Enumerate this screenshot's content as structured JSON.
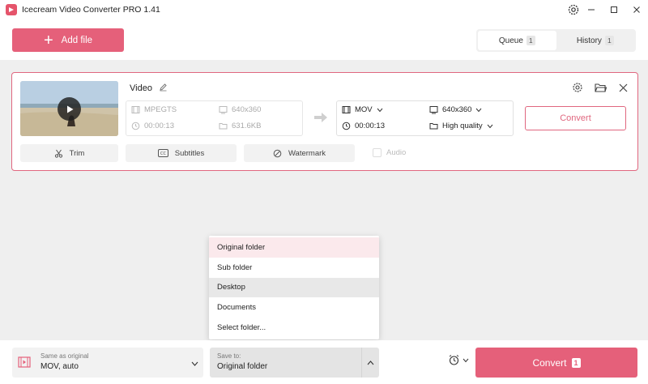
{
  "window": {
    "title": "Icecream Video Converter PRO 1.41"
  },
  "toolbar": {
    "add_file_label": "Add file",
    "tabs": [
      {
        "label": "Queue",
        "count": "1"
      },
      {
        "label": "History",
        "count": "1"
      }
    ]
  },
  "item": {
    "title": "Video",
    "source": {
      "format": "MPEGTS",
      "resolution": "640x360",
      "duration": "00:00:13",
      "size": "631.6KB"
    },
    "target": {
      "format": "MOV",
      "resolution": "640x360",
      "duration": "00:00:13",
      "quality": "High quality"
    },
    "convert_label": "Convert",
    "actions": {
      "trim": "Trim",
      "subtitles": "Subtitles",
      "watermark": "Watermark",
      "audio": "Audio"
    }
  },
  "dropdown": {
    "options": [
      "Original folder",
      "Sub folder",
      "Desktop",
      "Documents",
      "Select folder..."
    ]
  },
  "bottom": {
    "format_label": "Same as original",
    "format_value": "MOV, auto",
    "save_label": "Save to:",
    "save_value": "Original folder",
    "convert_label": "Convert",
    "convert_count": "1"
  },
  "colors": {
    "accent": "#e5607a"
  }
}
